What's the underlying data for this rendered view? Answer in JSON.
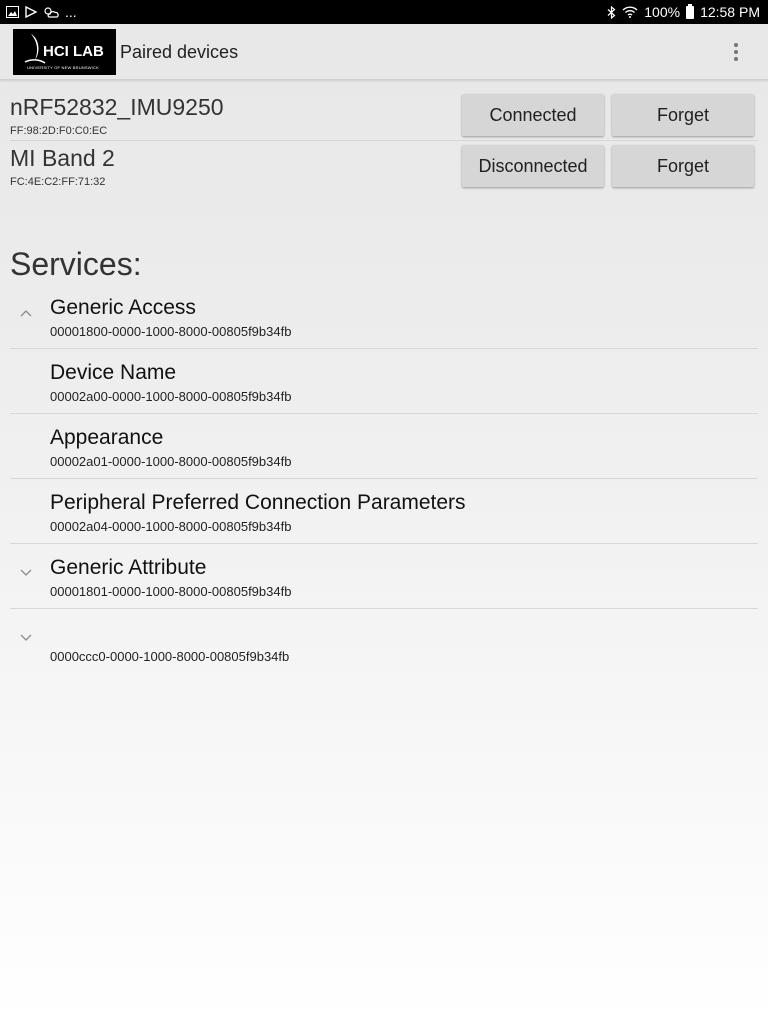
{
  "status_bar": {
    "left_extra": "...",
    "battery": "100%",
    "time": "12:58 PM"
  },
  "app_bar": {
    "logo_text": "HCI LAB",
    "logo_subtext": "UNIVERSITY OF NEW BRUNSWICK",
    "title": "Paired devices"
  },
  "devices": [
    {
      "name": "nRF52832_IMU9250",
      "address": "FF:98:2D:F0:C0:EC",
      "status_label": "Connected",
      "forget_label": "Forget"
    },
    {
      "name": "MI Band 2",
      "address": "FC:4E:C2:FF:71:32",
      "status_label": "Disconnected",
      "forget_label": "Forget"
    }
  ],
  "services_heading": "Services:",
  "services": [
    {
      "name": "Generic Access",
      "uuid": "00001800-0000-1000-8000-00805f9b34fb",
      "chevron": "chevron-up-icon"
    },
    {
      "name": "Device Name",
      "uuid": "00002a00-0000-1000-8000-00805f9b34fb",
      "chevron": ""
    },
    {
      "name": "Appearance",
      "uuid": "00002a01-0000-1000-8000-00805f9b34fb",
      "chevron": ""
    },
    {
      "name": "Peripheral Preferred Connection Parameters",
      "uuid": "00002a04-0000-1000-8000-00805f9b34fb",
      "chevron": ""
    },
    {
      "name": "Generic Attribute",
      "uuid": "00001801-0000-1000-8000-00805f9b34fb",
      "chevron": "chevron-down-icon"
    },
    {
      "name": "",
      "uuid": "0000ccc0-0000-1000-8000-00805f9b34fb",
      "chevron": "chevron-down-icon"
    }
  ]
}
